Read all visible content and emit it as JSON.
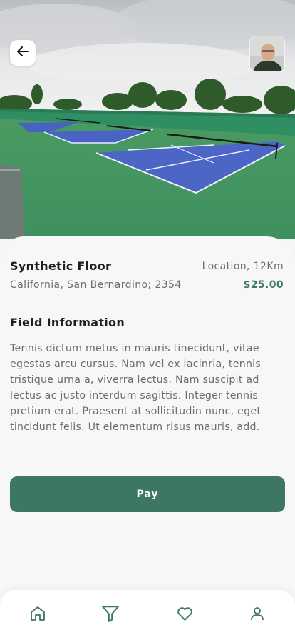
{
  "header": {
    "back_icon": "arrow-left-icon",
    "avatar_icon": "user-avatar-photo"
  },
  "field": {
    "name": "Synthetic Floor",
    "location_distance": "Location, 12Km",
    "address": "California, San Bernardino; 2354",
    "price": "$25.00"
  },
  "info": {
    "heading": "Field Information",
    "text": "Tennis dictum metus in mauris tinecidunt, vitae egestas arcu cursus. Nam vel ex lacinria, tennis tristique urna a, viverra lectus. Nam suscipit ad lectus ac justo interdum sagittis. Integer tennis pretium erat. Praesent at sollicitudin nunc, eget tincidunt felis. Ut elementum risus mauris, add."
  },
  "actions": {
    "pay_label": "Pay"
  },
  "nav": {
    "items": [
      {
        "icon": "home-icon",
        "active": false
      },
      {
        "icon": "filter-icon",
        "active": true
      },
      {
        "icon": "heart-icon",
        "active": false
      },
      {
        "icon": "profile-icon",
        "active": false
      }
    ]
  },
  "colors": {
    "accent": "#3d7763",
    "price": "#3f7a63",
    "court_blue": "#4a63c4",
    "court_green": "#3f9a67"
  }
}
